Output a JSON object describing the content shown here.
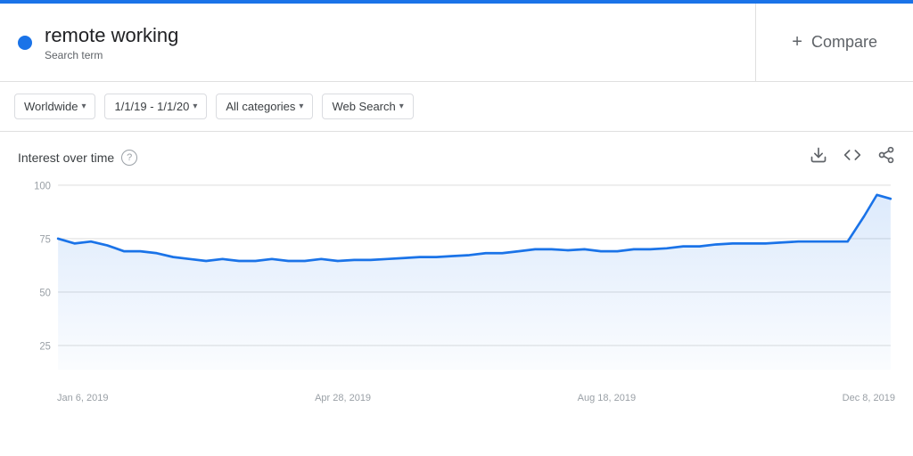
{
  "topBar": {},
  "searchTerm": {
    "title": "remote working",
    "subtitle": "Search term"
  },
  "compare": {
    "plus": "+",
    "label": "Compare"
  },
  "filters": [
    {
      "id": "geo",
      "label": "Worldwide"
    },
    {
      "id": "date",
      "label": "1/1/19 - 1/1/20"
    },
    {
      "id": "category",
      "label": "All categories"
    },
    {
      "id": "search",
      "label": "Web Search"
    }
  ],
  "chart": {
    "title": "Interest over time",
    "helpIcon": "?",
    "xLabels": [
      "Jan 6, 2019",
      "Apr 28, 2019",
      "Aug 18, 2019",
      "Dec 8, 2019"
    ],
    "yLabels": [
      "100",
      "75",
      "50",
      "25"
    ],
    "lineColor": "#1a73e8",
    "gridColor": "#e0e0e0"
  },
  "icons": {
    "download": "⬇",
    "code": "<>",
    "share": "↗"
  }
}
